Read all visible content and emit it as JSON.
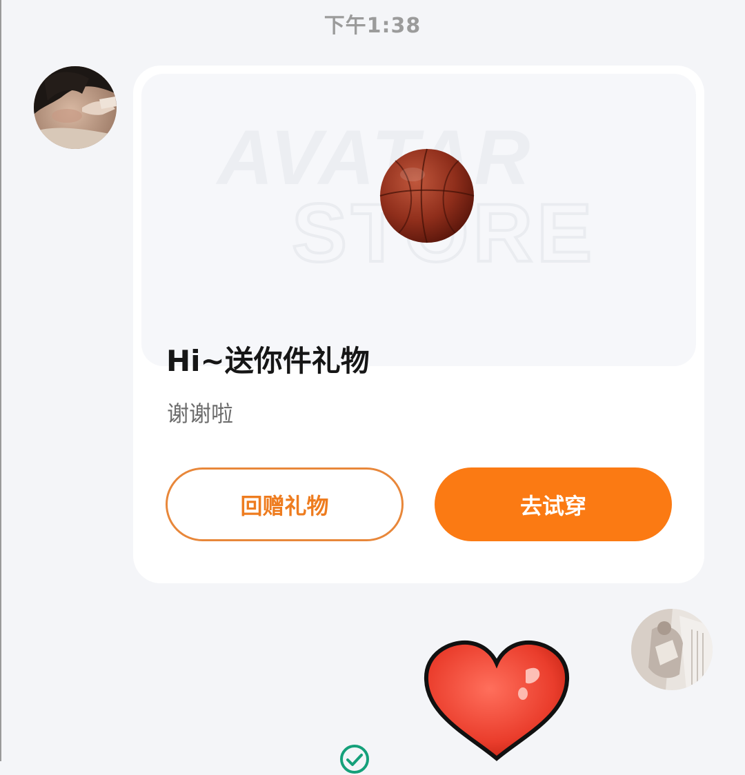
{
  "chat": {
    "timestamp": "下午1:38"
  },
  "gift_card": {
    "hero_watermark_line1": "AVATAR",
    "hero_watermark_line2": "STORE",
    "item_icon": "basketball-icon",
    "title": "Hi~送你件礼物",
    "subtitle": "谢谢啦",
    "return_gift_label": "回赠礼物",
    "try_on_label": "去试穿"
  },
  "colors": {
    "accent": "#fb7a13",
    "accent_outline": "#e8873a",
    "background": "#f4f5f8",
    "card": "#ffffff"
  },
  "sticker": {
    "icon": "heart-sticker"
  },
  "status": {
    "icon": "check-circle-icon"
  }
}
